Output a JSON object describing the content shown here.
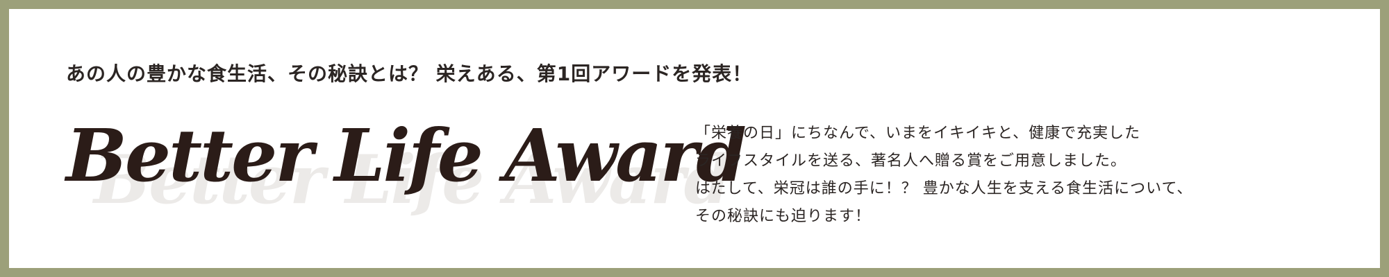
{
  "tagline": "あの人の豊かな食生活、その秘訣とは？ 栄えある、第1回アワードを発表！",
  "logo": {
    "text": "Better Life Award",
    "color": "#2b1c18",
    "shadow_color": "#eceae8"
  },
  "description": {
    "lines": [
      "「栄養の日」にちなんで、いまをイキイキと、健康で充実した",
      "ライフスタイルを送る、著名人へ贈る賞をご用意しました。",
      "はたして、栄冠は誰の手に！？ 豊かな人生を支える食生活について、",
      "その秘訣にも迫ります！"
    ]
  },
  "colors": {
    "border": "#9ca07a",
    "background": "#ffffff",
    "text": "#2b2523"
  }
}
